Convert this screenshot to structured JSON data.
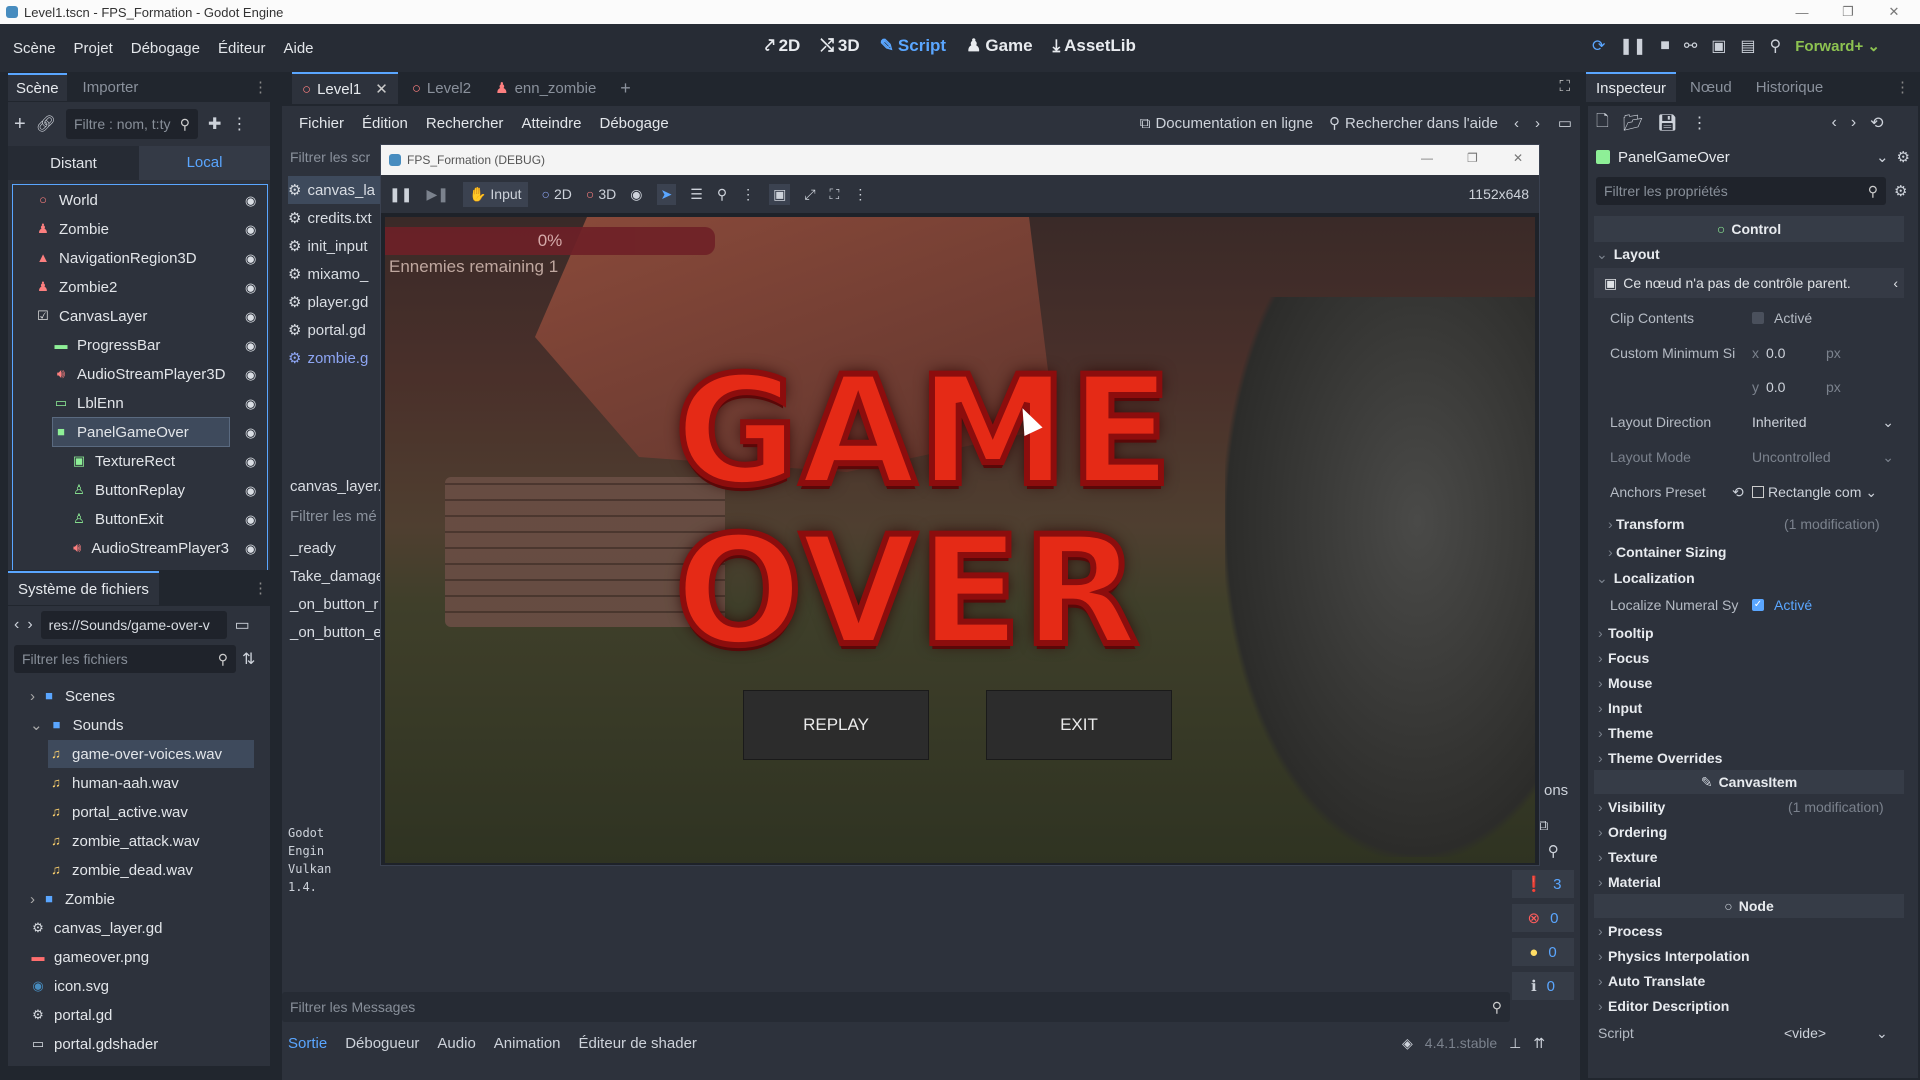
{
  "window": {
    "title": "Level1.tscn - FPS_Formation - Godot Engine"
  },
  "menubar": {
    "items": [
      "Scène",
      "Projet",
      "Débogage",
      "Éditeur",
      "Aide"
    ],
    "workspaces": [
      "2D",
      "3D",
      "Script",
      "Game",
      "AssetLib"
    ],
    "renderer": "Forward+"
  },
  "scene_dock": {
    "tabs": [
      "Scène",
      "Importer"
    ],
    "filter_placeholder": "Filtre : nom, t:ty",
    "mode_tabs": [
      "Distant",
      "Local"
    ],
    "nodes": [
      {
        "name": "World",
        "icon": "node3d-icon",
        "color": "#fc7f7f"
      },
      {
        "name": "Zombie",
        "icon": "character-icon",
        "color": "#fc7f7f"
      },
      {
        "name": "NavigationRegion3D",
        "icon": "navigation-icon",
        "color": "#fc7f7f"
      },
      {
        "name": "Zombie2",
        "icon": "character-icon",
        "color": "#fc7f7f"
      },
      {
        "name": "CanvasLayer",
        "icon": "canvaslayer-icon",
        "color": "#e0e0e0"
      },
      {
        "name": "ProgressBar",
        "icon": "progressbar-icon",
        "color": "#8eef97"
      },
      {
        "name": "AudioStreamPlayer3D",
        "icon": "audio-icon",
        "color": "#fc7f7f"
      },
      {
        "name": "LblEnn",
        "icon": "label-icon",
        "color": "#8eef97"
      },
      {
        "name": "PanelGameOver",
        "icon": "panel-icon",
        "color": "#8eef97"
      },
      {
        "name": "TextureRect",
        "icon": "texturerect-icon",
        "color": "#8eef97"
      },
      {
        "name": "ButtonReplay",
        "icon": "button-icon",
        "color": "#8eef97"
      },
      {
        "name": "ButtonExit",
        "icon": "button-icon",
        "color": "#8eef97"
      },
      {
        "name": "AudioStreamPlayer3",
        "icon": "audio-icon",
        "color": "#fc7f7f"
      }
    ]
  },
  "filesystem_dock": {
    "title": "Système de fichiers",
    "path": "res://Sounds/game-over-v",
    "filter_placeholder": "Filtrer les fichiers",
    "items": [
      {
        "name": "Scenes",
        "type": "folder"
      },
      {
        "name": "Sounds",
        "type": "folder"
      },
      {
        "name": "game-over-voices.wav",
        "type": "audio"
      },
      {
        "name": "human-aah.wav",
        "type": "audio"
      },
      {
        "name": "portal_active.wav",
        "type": "audio"
      },
      {
        "name": "zombie_attack.wav",
        "type": "audio"
      },
      {
        "name": "zombie_dead.wav",
        "type": "audio"
      },
      {
        "name": "Zombie",
        "type": "folder"
      },
      {
        "name": "canvas_layer.gd",
        "type": "script"
      },
      {
        "name": "gameover.png",
        "type": "image"
      },
      {
        "name": "icon.svg",
        "type": "svg"
      },
      {
        "name": "portal.gd",
        "type": "script"
      },
      {
        "name": "portal.gdshader",
        "type": "shader"
      }
    ]
  },
  "editor_tabs": [
    "Level1",
    "Level2",
    "enn_zombie"
  ],
  "script_menu": {
    "items": [
      "Fichier",
      "Édition",
      "Rechercher",
      "Atteindre",
      "Débogage"
    ],
    "doc_link": "Documentation en ligne",
    "help_search": "Rechercher dans l'aide",
    "filter_scripts": "Filtrer les scr",
    "scripts": [
      "canvas_la",
      "credits.txt",
      "init_input",
      "mixamo_",
      "player.gd",
      "portal.gd",
      "zombie.g"
    ],
    "current_script": "canvas_layer.",
    "filter_methods": "Filtrer les mé",
    "methods": [
      "_ready",
      "Take_damage",
      "_on_button_r",
      "_on_button_e"
    ]
  },
  "output": {
    "log": [
      "Godot Engin",
      "Vulkan 1.4."
    ],
    "counts": {
      "messages": "3",
      "errors": "0",
      "warnings": "0",
      "info": "0"
    },
    "filter_placeholder": "Filtrer les Messages",
    "bottom_tabs": [
      "Sortie",
      "Débogueur",
      "Audio",
      "Animation",
      "Éditeur de shader"
    ],
    "version": "4.4.1.stable",
    "side_label": "ons"
  },
  "game_window": {
    "title": "FPS_Formation (DEBUG)",
    "toolbar": {
      "input": "Input",
      "mode2d": "2D",
      "mode3d": "3D",
      "resolution": "1152x648"
    },
    "hud": {
      "progress_text": "0%",
      "progress_value": 0,
      "enemies": "Ennemies remaining 1"
    },
    "game_over": {
      "line1": "GAME",
      "line2": "OVER"
    },
    "buttons": {
      "replay": "REPLAY",
      "exit": "EXIT"
    }
  },
  "inspector": {
    "tabs": [
      "Inspecteur",
      "Nœud",
      "Historique"
    ],
    "node_name": "PanelGameOver",
    "filter_placeholder": "Filtrer les propriétés",
    "category_control": "Control",
    "layout_section": "Layout",
    "warning": "Ce nœud n'a pas de contrôle parent.",
    "props": {
      "clip_contents": "Clip Contents",
      "clip_value": "Activé",
      "custom_min": "Custom Minimum Si",
      "min_x": "0.0",
      "min_y": "0.0",
      "unit": "px",
      "layout_direction": "Layout Direction",
      "layout_direction_value": "Inherited",
      "layout_mode": "Layout Mode",
      "layout_mode_value": "Uncontrolled",
      "anchors": "Anchors Preset",
      "anchors_value": "Rectangle com",
      "transform": "Transform",
      "modification": "(1 modification)",
      "container_sizing": "Container Sizing",
      "localization": "Localization",
      "localize_numeral": "Localize Numeral Sy",
      "localize_value": "Activé"
    },
    "sections_control": [
      "Tooltip",
      "Focus",
      "Mouse",
      "Input",
      "Theme",
      "Theme Overrides"
    ],
    "category_canvasitem": "CanvasItem",
    "sections_canvas": [
      "Visibility",
      "Ordering",
      "Texture",
      "Material"
    ],
    "visibility_mod": "(1 modification)",
    "category_node": "Node",
    "sections_node": [
      "Process",
      "Physics Interpolation",
      "Auto Translate",
      "Editor Description"
    ],
    "script_label": "Script",
    "script_value": "<vide>"
  }
}
